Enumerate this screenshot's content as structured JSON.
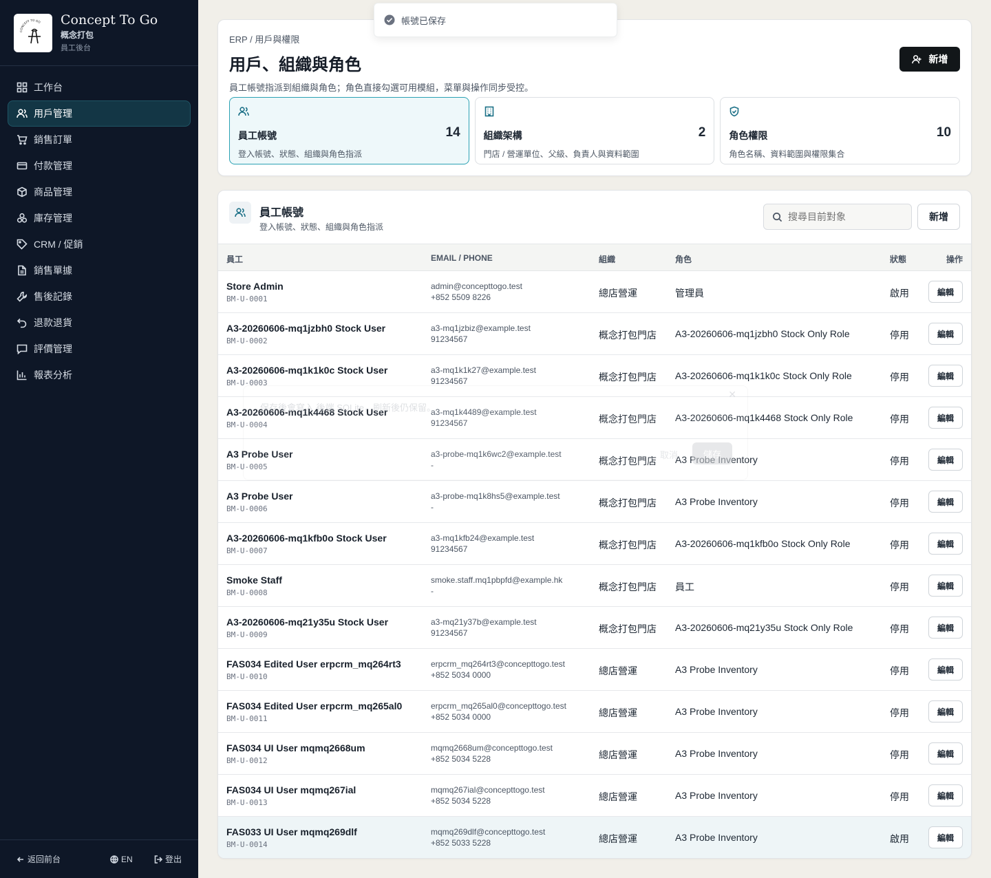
{
  "brand": {
    "title": "Concept To Go",
    "subtitle": "概念打包",
    "subtitle2": "員工後台",
    "logo_text": "CONCEPT TO GO"
  },
  "sidebar": {
    "items": [
      {
        "label": "工作台",
        "icon": "grid-icon",
        "active": false
      },
      {
        "label": "用戶管理",
        "icon": "users-icon",
        "active": true
      },
      {
        "label": "銷售訂單",
        "icon": "cart-icon",
        "active": false
      },
      {
        "label": "付款管理",
        "icon": "card-icon",
        "active": false
      },
      {
        "label": "商品管理",
        "icon": "box-icon",
        "active": false
      },
      {
        "label": "庫存管理",
        "icon": "boxes-icon",
        "active": false
      },
      {
        "label": "CRM / 促銷",
        "icon": "tag-icon",
        "active": false
      },
      {
        "label": "銷售單據",
        "icon": "file-icon",
        "active": false
      },
      {
        "label": "售後記錄",
        "icon": "wrench-icon",
        "active": false
      },
      {
        "label": "退款退貨",
        "icon": "undo-icon",
        "active": false
      },
      {
        "label": "評價管理",
        "icon": "message-icon",
        "active": false
      },
      {
        "label": "報表分析",
        "icon": "chart-icon",
        "active": false
      }
    ],
    "footer": {
      "back": "返回前台",
      "lang": "EN",
      "logout": "登出"
    }
  },
  "toast": {
    "text": "帳號已保存"
  },
  "header": {
    "breadcrumb": "ERP / 用戶與權限",
    "title": "用戶、組織與角色",
    "description": "員工帳號指派到組織與角色；角色直接勾選可用模組，菜單與操作同步受控。",
    "add_label": "新增"
  },
  "stats": [
    {
      "title": "員工帳號",
      "desc": "登入帳號、狀態、組織與角色指派",
      "count": "14",
      "icon": "users-icon",
      "active": true
    },
    {
      "title": "組織架構",
      "desc": "門店 / 營運單位、父級、負責人與資料範圍",
      "count": "2",
      "icon": "building-icon",
      "active": false
    },
    {
      "title": "角色權限",
      "desc": "角色名稱、資料範圍與權限集合",
      "count": "10",
      "icon": "shield-icon",
      "active": false
    }
  ],
  "list": {
    "title": "員工帳號",
    "desc": "登入帳號、狀態、組織與角色指派",
    "search_placeholder": "搜尋目前對象",
    "add_label": "新增",
    "columns": {
      "employee": "員工",
      "contact": "EMAIL / PHONE",
      "org": "組織",
      "role": "角色",
      "status": "狀態",
      "actions": "操作"
    },
    "edit_label": "編輯",
    "rows": [
      {
        "name": "Store Admin",
        "code": "BM-U-0001",
        "email": "admin@concepttogo.test",
        "phone": "+852 5509 8226",
        "org": "總店營運",
        "role": "管理員",
        "status": "啟用"
      },
      {
        "name": "A3-20260606-mq1jzbh0 Stock User",
        "code": "BM-U-0002",
        "email": "a3-mq1jzbiz@example.test",
        "phone": "91234567",
        "org": "概念打包門店",
        "role": "A3-20260606-mq1jzbh0 Stock Only Role",
        "status": "停用"
      },
      {
        "name": "A3-20260606-mq1k1k0c Stock User",
        "code": "BM-U-0003",
        "email": "a3-mq1k1k27@example.test",
        "phone": "91234567",
        "org": "概念打包門店",
        "role": "A3-20260606-mq1k1k0c Stock Only Role",
        "status": "停用"
      },
      {
        "name": "A3-20260606-mq1k4468 Stock User",
        "code": "BM-U-0004",
        "email": "a3-mq1k4489@example.test",
        "phone": "91234567",
        "org": "概念打包門店",
        "role": "A3-20260606-mq1k4468 Stock Only Role",
        "status": "停用"
      },
      {
        "name": "A3 Probe User",
        "code": "BM-U-0005",
        "email": "a3-probe-mq1k6wc2@example.test",
        "phone": "-",
        "org": "概念打包門店",
        "role": "A3 Probe Inventory",
        "status": "停用"
      },
      {
        "name": "A3 Probe User",
        "code": "BM-U-0006",
        "email": "a3-probe-mq1k8hs5@example.test",
        "phone": "-",
        "org": "概念打包門店",
        "role": "A3 Probe Inventory",
        "status": "停用"
      },
      {
        "name": "A3-20260606-mq1kfb0o Stock User",
        "code": "BM-U-0007",
        "email": "a3-mq1kfb24@example.test",
        "phone": "91234567",
        "org": "概念打包門店",
        "role": "A3-20260606-mq1kfb0o Stock Only Role",
        "status": "停用"
      },
      {
        "name": "Smoke Staff",
        "code": "BM-U-0008",
        "email": "smoke.staff.mq1pbpfd@example.hk",
        "phone": "-",
        "org": "概念打包門店",
        "role": "員工",
        "status": "停用"
      },
      {
        "name": "A3-20260606-mq21y35u Stock User",
        "code": "BM-U-0009",
        "email": "a3-mq21y37b@example.test",
        "phone": "91234567",
        "org": "概念打包門店",
        "role": "A3-20260606-mq21y35u Stock Only Role",
        "status": "停用"
      },
      {
        "name": "FAS034 Edited User erpcrm_mq264rt3",
        "code": "BM-U-0010",
        "email": "erpcrm_mq264rt3@concepttogo.test",
        "phone": "+852 5034 0000",
        "org": "總店營運",
        "role": "A3 Probe Inventory",
        "status": "停用"
      },
      {
        "name": "FAS034 Edited User erpcrm_mq265al0",
        "code": "BM-U-0011",
        "email": "erpcrm_mq265al0@concepttogo.test",
        "phone": "+852 5034 0000",
        "org": "總店營運",
        "role": "A3 Probe Inventory",
        "status": "停用"
      },
      {
        "name": "FAS034 UI User mqmq2668um",
        "code": "BM-U-0012",
        "email": "mqmq2668um@concepttogo.test",
        "phone": "+852 5034 5228",
        "org": "總店營運",
        "role": "A3 Probe Inventory",
        "status": "停用"
      },
      {
        "name": "FAS034 UI User mqmq267ial",
        "code": "BM-U-0013",
        "email": "mqmq267ial@concepttogo.test",
        "phone": "+852 5034 5228",
        "org": "總店營運",
        "role": "A3 Probe Inventory",
        "status": "停用"
      },
      {
        "name": "FAS033 UI User mqmq269dlf",
        "code": "BM-U-0014",
        "email": "mqmq269dlf@concepttogo.test",
        "phone": "+852 5033 5228",
        "org": "總店營運",
        "role": "A3 Probe Inventory",
        "status": "啟用",
        "highlight": true
      }
    ]
  },
  "dialog_ghost": {
    "text": "保存後會寫入 後端 SQLite，刷新後仍保留。",
    "cancel": "取消",
    "save": "儲存"
  }
}
